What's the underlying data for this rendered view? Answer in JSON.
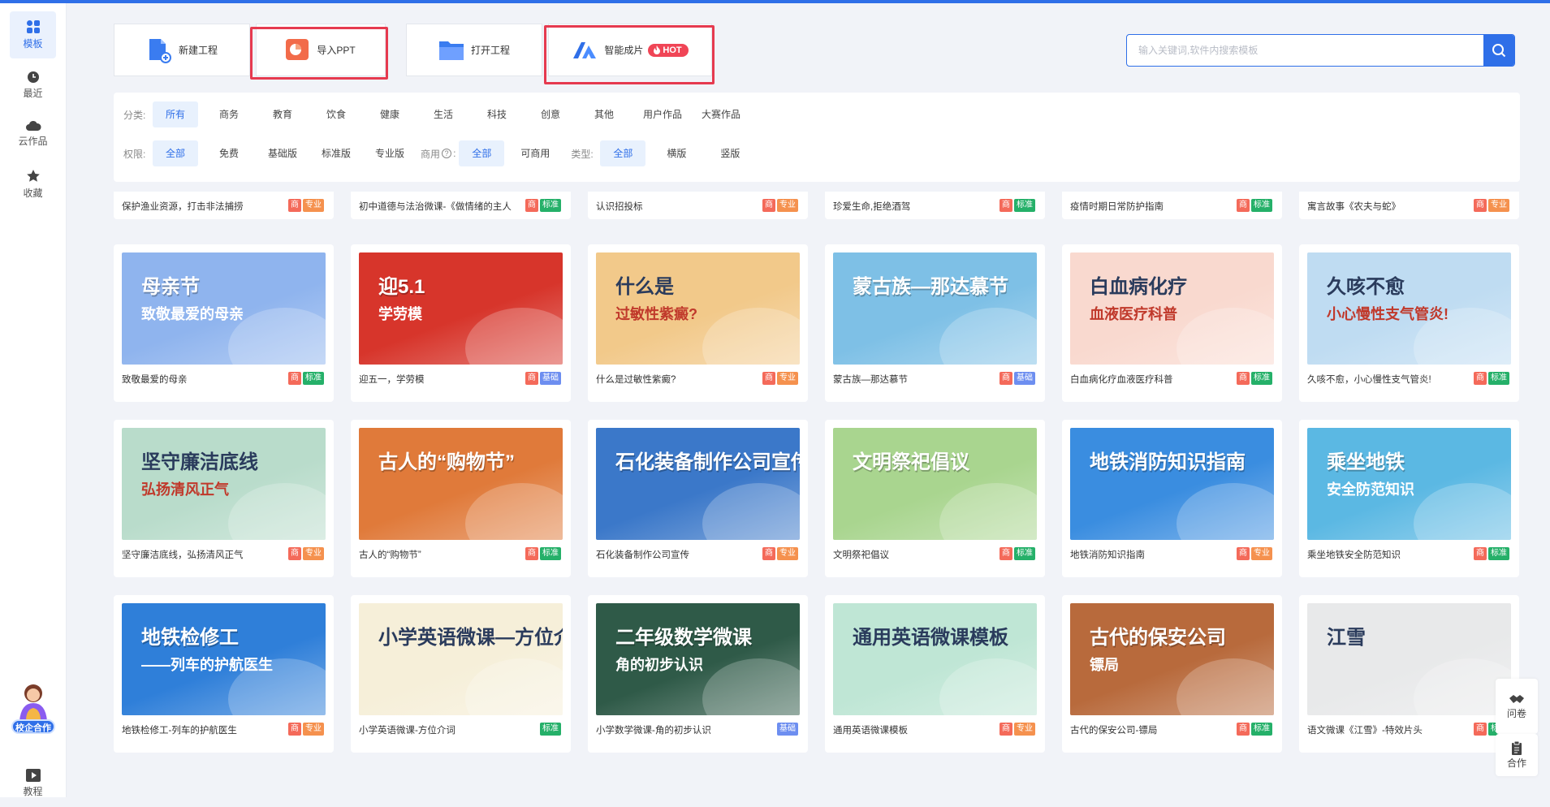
{
  "sidebar": {
    "items": [
      {
        "label": "模板",
        "icon": "grid-icon"
      },
      {
        "label": "最近",
        "icon": "clock-icon"
      },
      {
        "label": "云作品",
        "icon": "cloud-icon"
      },
      {
        "label": "收藏",
        "icon": "star-icon"
      }
    ],
    "promo_label": "校企合作",
    "tutorial_label": "教程"
  },
  "actions": {
    "new_project": "新建工程",
    "import_ppt": "导入PPT",
    "open_project": "打开工程",
    "smart_video": "智能成片",
    "hot_badge": "HOT"
  },
  "search": {
    "placeholder": "输入关键词,软件内搜索模板"
  },
  "filters": {
    "category_label": "分类:",
    "categories": [
      "所有",
      "商务",
      "教育",
      "饮食",
      "健康",
      "生活",
      "科技",
      "创意",
      "其他",
      "用户作品",
      "大赛作品"
    ],
    "permission_label": "权限:",
    "permissions": [
      "全部",
      "免费",
      "基础版",
      "标准版",
      "专业版"
    ],
    "commercial_label": "商用",
    "commercial_opts": [
      "全部",
      "可商用"
    ],
    "type_label": "类型:",
    "types": [
      "全部",
      "横版",
      "竖版"
    ]
  },
  "partial_row": [
    {
      "name": "保护渔业资源，打击非法捕捞",
      "tags": [
        "商",
        "专业"
      ]
    },
    {
      "name": "初中道德与法治微课-《做情绪的主人",
      "tags": [
        "商",
        "标准"
      ]
    },
    {
      "name": "认识招投标",
      "tags": [
        "商",
        "专业"
      ]
    },
    {
      "name": "珍爱生命,拒绝酒驾",
      "tags": [
        "商",
        "标准"
      ]
    },
    {
      "name": "疫情时期日常防护指南",
      "tags": [
        "商",
        "标准"
      ]
    },
    {
      "name": "寓言故事《农夫与蛇》",
      "tags": [
        "商",
        "专业"
      ]
    }
  ],
  "cards": [
    {
      "name": "致敬最爱的母亲",
      "tags": [
        "商",
        "标准"
      ],
      "thumb_title": "母亲节",
      "thumb_sub": "致敬最爱的母亲",
      "bg": "#8fb4ee"
    },
    {
      "name": "迎五一，学劳模",
      "tags": [
        "商",
        "基础"
      ],
      "thumb_title": "迎5.1",
      "thumb_sub": "学劳模",
      "bg": "#d7352b"
    },
    {
      "name": "什么是过敏性紫癜?",
      "tags": [
        "商",
        "专业"
      ],
      "thumb_title": "什么是",
      "thumb_sub": "过敏性紫癜?",
      "bg": "#f2c98a"
    },
    {
      "name": "蒙古族—那达慕节",
      "tags": [
        "商",
        "基础"
      ],
      "thumb_title": "蒙古族—那达慕节",
      "thumb_sub": "",
      "bg": "#7ec0e6"
    },
    {
      "name": "白血病化疗血液医疗科普",
      "tags": [
        "商",
        "标准"
      ],
      "thumb_title": "白血病化疗",
      "thumb_sub": "血液医疗科普",
      "bg": "#f9d9cf"
    },
    {
      "name": "久咳不愈，小心慢性支气管炎!",
      "tags": [
        "商",
        "标准"
      ],
      "thumb_title": "久咳不愈",
      "thumb_sub": "小心慢性支气管炎!",
      "bg": "#bfdcf2"
    },
    {
      "name": "坚守廉洁底线，弘扬清风正气",
      "tags": [
        "商",
        "专业"
      ],
      "thumb_title": "坚守廉洁底线",
      "thumb_sub": "弘扬清风正气",
      "bg": "#b9dccb"
    },
    {
      "name": "古人的“购物节”",
      "tags": [
        "商",
        "标准"
      ],
      "thumb_title": "古人的“购物节”",
      "thumb_sub": "",
      "bg": "#e07a3a"
    },
    {
      "name": "石化装备制作公司宣传",
      "tags": [
        "商",
        "专业"
      ],
      "thumb_title": "石化装备制作公司宣传",
      "thumb_sub": "",
      "bg": "#3b78c9"
    },
    {
      "name": "文明祭祀倡议",
      "tags": [
        "商",
        "标准"
      ],
      "thumb_title": "文明祭祀倡议",
      "thumb_sub": "",
      "bg": "#a9d58f"
    },
    {
      "name": "地铁消防知识指南",
      "tags": [
        "商",
        "专业"
      ],
      "thumb_title": "地铁消防知识指南",
      "thumb_sub": "",
      "bg": "#3a8de0"
    },
    {
      "name": "乘坐地铁安全防范知识",
      "tags": [
        "商",
        "标准"
      ],
      "thumb_title": "乘坐地铁",
      "thumb_sub": "安全防范知识",
      "bg": "#5bb8e3"
    },
    {
      "name": "地铁检修工-列车的护航医生",
      "tags": [
        "商",
        "专业"
      ],
      "thumb_title": "地铁检修工",
      "thumb_sub": "——列车的护航医生",
      "bg": "#2f7fd9"
    },
    {
      "name": "小学英语微课-方位介词",
      "tags": [
        "标准"
      ],
      "thumb_title": "小学英语微课—方位介词",
      "thumb_sub": "",
      "bg": "#f6efd9"
    },
    {
      "name": "小学数学微课-角的初步认识",
      "tags": [
        "基础"
      ],
      "thumb_title": "二年级数学微课",
      "thumb_sub": "角的初步认识",
      "bg": "#2f5a48"
    },
    {
      "name": "通用英语微课模板",
      "tags": [
        "商",
        "专业"
      ],
      "thumb_title": "通用英语微课模板",
      "thumb_sub": "",
      "bg": "#bfe6d5"
    },
    {
      "name": "古代的保安公司-镖局",
      "tags": [
        "商",
        "标准"
      ],
      "thumb_title": "古代的保安公司",
      "thumb_sub": "镖局",
      "bg": "#b86a3c"
    },
    {
      "name": "语文微课《江雪》-特效片头",
      "tags": [
        "商",
        "标准"
      ],
      "thumb_title": "江雪",
      "thumb_sub": "",
      "bg": "#e8e9ea"
    }
  ],
  "float_panel": {
    "questionnaire": "问卷",
    "cooperate": "合作"
  },
  "colors": {
    "accent": "#2f6fe8",
    "highlight": "#e63a4f",
    "tag_commercial": "#f46a5a",
    "tag_pro": "#f5914e",
    "tag_standard": "#25b069",
    "tag_basic": "#6d8ef0"
  }
}
